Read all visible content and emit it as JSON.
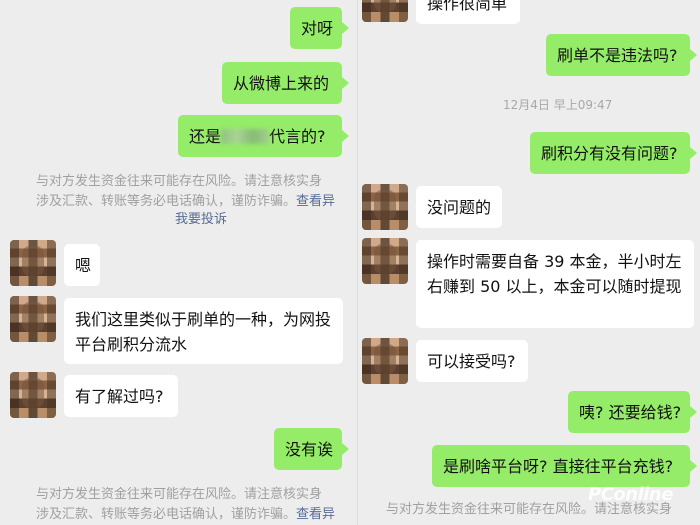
{
  "left": {
    "sent_1": "对呀",
    "sent_2": "从微博上来的",
    "sent_3_prefix": "还是",
    "sent_3_suffix": "代言的?",
    "notice_1_line1": "与对方发生资金往来可能存在风险。请注意核实身",
    "notice_1_line2": "涉及汇款、转账等务必电话确认，谨防诈骗。",
    "notice_1_link": "查看异",
    "notice_1_report": "我要投诉",
    "recv_1": "嗯",
    "recv_2": "我们这里类似于刷单的一种，为网投平台刷积分流水",
    "recv_3": "有了解过吗?",
    "sent_4": "没有诶",
    "notice_2_line1": "与对方发生资金往来可能存在风险。请注意核实身",
    "notice_2_line2": "涉及汇款、转账等务必电话确认，谨防诈骗。",
    "notice_2_link": "查看异"
  },
  "right": {
    "recv_0": "操作很简单",
    "sent_1": "刷单不是违法吗?",
    "timestamp": "12月4日 早上09:47",
    "sent_2": "刷积分有没有问题?",
    "recv_1": "没问题的",
    "recv_2": "操作时需要自备 39 本金，半小时左右赚到 50 以上，本金可以随时提现",
    "recv_3": "可以接受吗?",
    "sent_3": "咦? 还要给钱?",
    "sent_4": "是刷啥平台呀? 直接往平台充钱?",
    "notice_line1": "与对方发生资金往来可能存在风险。请注意核实身"
  },
  "watermark": "PConline"
}
